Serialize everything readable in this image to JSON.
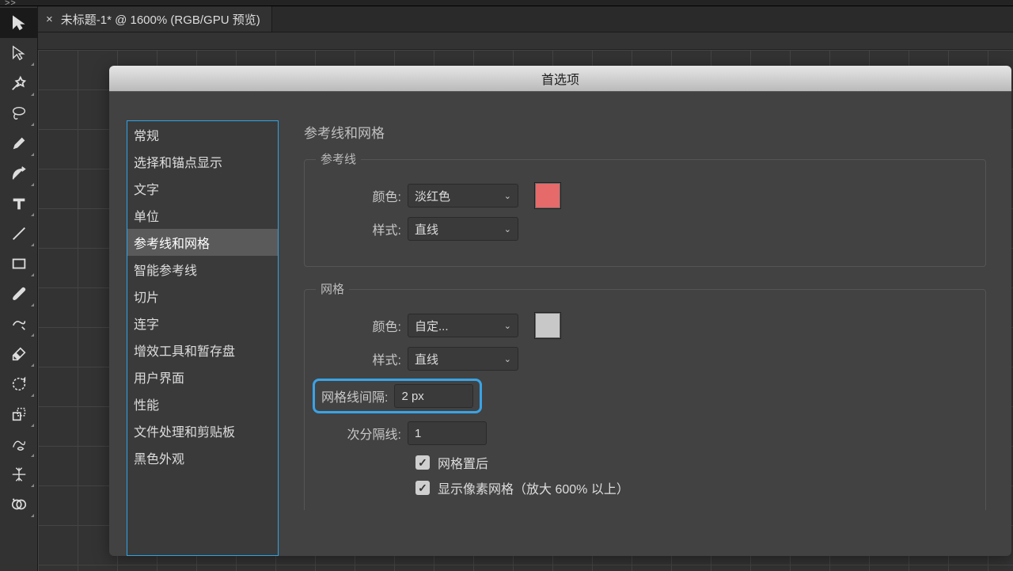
{
  "expand_indicator": ">>",
  "tab": {
    "title": "未标题-1* @ 1600% (RGB/GPU 预览)"
  },
  "dialog": {
    "title": "首选项"
  },
  "pref_categories": [
    "常规",
    "选择和锚点显示",
    "文字",
    "单位",
    "参考线和网格",
    "智能参考线",
    "切片",
    "连字",
    "增效工具和暂存盘",
    "用户界面",
    "性能",
    "文件处理和剪贴板",
    "黑色外观"
  ],
  "selected_category_index": 4,
  "panel": {
    "title": "参考线和网格",
    "guides": {
      "group_label": "参考线",
      "color_label": "颜色:",
      "color_value": "淡红色",
      "color_hex": "#e76a6a",
      "style_label": "样式:",
      "style_value": "直线"
    },
    "grid": {
      "group_label": "网格",
      "color_label": "颜色:",
      "color_value": "自定...",
      "color_hex": "#c8c8c8",
      "style_label": "样式:",
      "style_value": "直线",
      "spacing_label": "网格线间隔:",
      "spacing_value": "2 px",
      "subdiv_label": "次分隔线:",
      "subdiv_value": "1",
      "back_label": "网格置后",
      "pixel_label": "显示像素网格（放大 600% 以上）"
    }
  }
}
